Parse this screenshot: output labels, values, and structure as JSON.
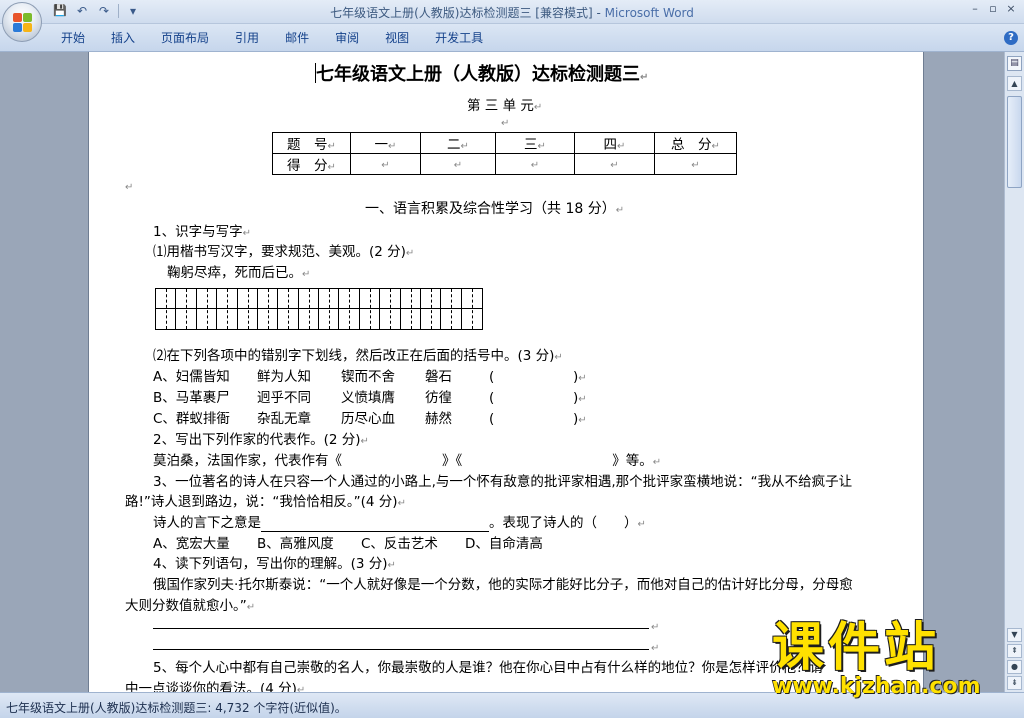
{
  "window": {
    "title": "七年级语文上册(人教版)达标检测题三 [兼容模式] - ",
    "app_name": "Microsoft Word",
    "controls": [
      "–",
      "▫",
      "×"
    ]
  },
  "qat": {
    "save": "💾",
    "undo": "↶",
    "redo": "↷",
    "customize": "▾"
  },
  "tabs": [
    "开始",
    "插入",
    "页面布局",
    "引用",
    "邮件",
    "审阅",
    "视图",
    "开发工具"
  ],
  "help": "?",
  "status": {
    "text": "七年级语文上册(人教版)达标检测题三: 4,732 个字符(近似值)。"
  },
  "pm": "↵",
  "doc": {
    "title": "七年级语文上册（人教版）达标检测题三",
    "unit": "第 三 单 元",
    "score_table": {
      "row1": [
        "题　号",
        "一",
        "二",
        "三",
        "四",
        "总　分"
      ],
      "row2": [
        "得　分",
        "",
        "",
        "",
        "",
        ""
      ]
    },
    "section1": "一、语言积累及综合性学习（共 18 分）",
    "q1": "1、识字与写字",
    "q1_1": "⑴用楷书写汉字，要求规范、美观。(2 分)",
    "q1_1_text": "鞠躬尽瘁，死而后已。",
    "q1_2": "⑵在下列各项中的错别字下划线，然后改正在后面的括号中。(3 分)",
    "q1_2_options": [
      {
        "label": "A、妇儒皆知",
        "w2": "鲜为人知",
        "w3": "锲而不舍",
        "w4": "磐石",
        "paren_l": "(",
        "paren_r": ")"
      },
      {
        "label": "B、马革裹尸",
        "w2": "迥乎不同",
        "w3": "义愤填膺",
        "w4": "彷徨",
        "paren_l": "(",
        "paren_r": ")"
      },
      {
        "label": "C、群蚁排衙",
        "w2": "杂乱无章",
        "w3": "历尽心血",
        "w4": "赫然",
        "paren_l": "(",
        "paren_r": ")"
      }
    ],
    "q2": "2、写出下列作家的代表作。(2 分)",
    "q2_text_a": "莫泊桑，法国作家，代表作有《",
    "q2_text_b": "》《",
    "q2_text_c": "》等。",
    "q3_line1": "3、一位著名的诗人在只容一个人通过的小路上,与一个怀有敌意的批评家相遇,那个批评家蛮横地说：“我从不给疯子让",
    "q3_line2": "路!”诗人退到路边，说：“我恰恰相反。”(4 分)",
    "q3_fill_a": "诗人的言下之意是",
    "q3_fill_b": "。表现了诗人的（　　）",
    "q3_choices": [
      "A、宽宏大量",
      "B、高雅风度",
      "C、反击艺术",
      "D、自命清高"
    ],
    "q4": "4、读下列语句，写出你的理解。(3 分)",
    "q4_line1": "俄国作家列夫·托尔斯泰说：“一个人就好像是一个分数，他的实际才能好比分子，而他对自己的估计好比分母，分母愈",
    "q4_line2": "大则分数值就愈小。”",
    "q5_line1": "5、每个人心中都有自己崇敬的名人，你最崇敬的人是谁？他在你心目中占有什么样的地位？你是怎样评价他？请",
    "q5_line2": "中一点谈谈你的看法。(4 分)"
  },
  "watermark": {
    "top": "课件站",
    "bottom": "www.kjzhan.com"
  }
}
